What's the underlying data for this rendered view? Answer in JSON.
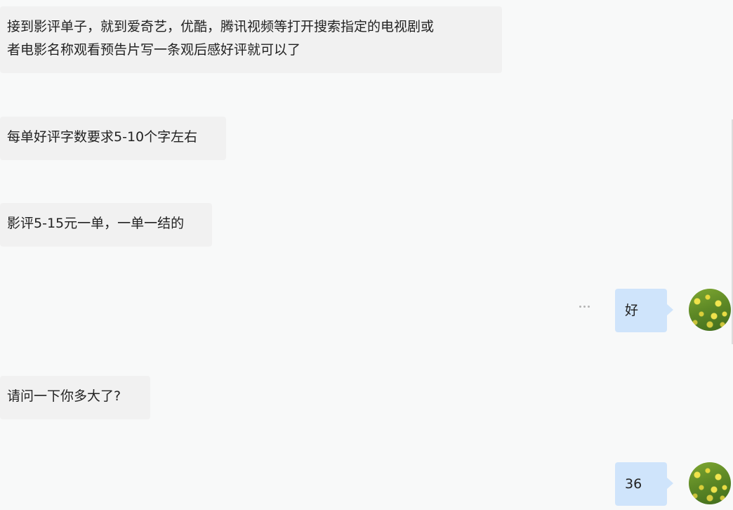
{
  "messages": [
    {
      "side": "in",
      "text": "接到影评单子，就到爱奇艺，优酷，腾讯视频等打开搜索指定的电视剧或\n者电影名称观看预告片写一条观后感好评就可以了"
    },
    {
      "side": "in",
      "text": "每单好评字数要求5-10个字左右"
    },
    {
      "side": "in",
      "text": "影评5-15元一单，一单一结的"
    },
    {
      "side": "out",
      "text": "好"
    },
    {
      "side": "in",
      "text": "请问一下你多大了?"
    },
    {
      "side": "out",
      "text": "36"
    }
  ],
  "colors": {
    "background": "#f8f9f9",
    "incoming_bubble": "#f1f1f1",
    "outgoing_bubble": "#cfe4fb"
  }
}
